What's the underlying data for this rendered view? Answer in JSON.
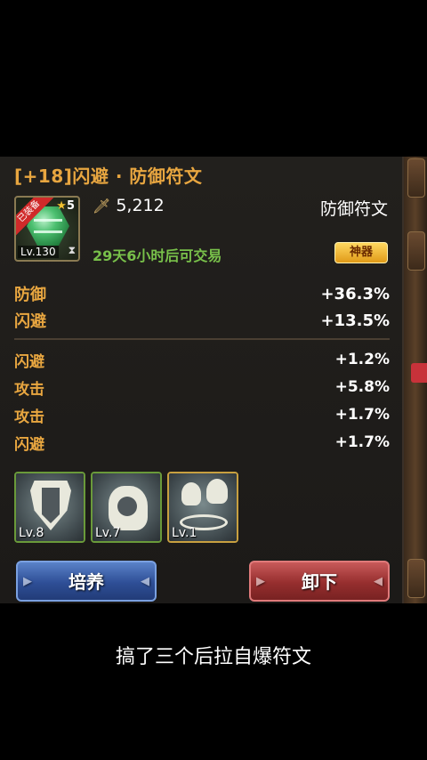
{
  "item": {
    "title": "[+18]闪避 · 防御符文",
    "ribbon": "已装备",
    "stars": "5",
    "level": "Lv.130",
    "power": "5,212",
    "rune_type": "防御符文",
    "trade_note": "29天6小时后可交易",
    "badge": "神器"
  },
  "main_stats": [
    {
      "name": "防御",
      "value": "+36.3%"
    },
    {
      "name": "闪避",
      "value": "+13.5%"
    }
  ],
  "sub_stats": [
    {
      "name": "闪避",
      "value": "+1.2%"
    },
    {
      "name": "攻击",
      "value": "+5.8%"
    },
    {
      "name": "攻击",
      "value": "+1.7%"
    },
    {
      "name": "闪避",
      "value": "+1.7%"
    }
  ],
  "skills": [
    {
      "level": "Lv.8",
      "icon": "shield-icon"
    },
    {
      "level": "Lv.7",
      "icon": "fist-icon"
    },
    {
      "level": "Lv.1",
      "icon": "ghost-icon"
    }
  ],
  "buttons": {
    "train": "培养",
    "unequip": "卸下"
  },
  "caption": "搞了三个后拉自爆符文",
  "colors": {
    "title": "#e8a640",
    "trade": "#78c04a",
    "train_button": "#2e4e96",
    "unequip_button": "#962e2e"
  }
}
